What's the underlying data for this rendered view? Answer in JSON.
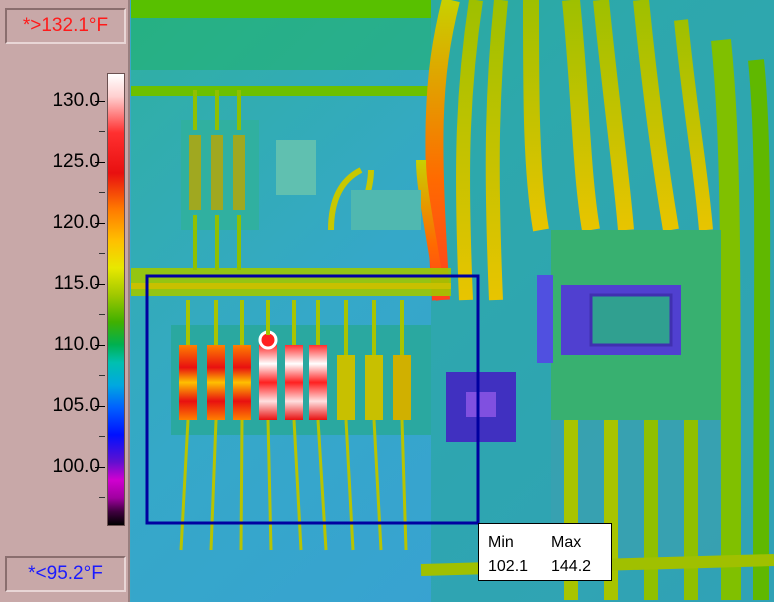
{
  "scale": {
    "max_readout": "*>132.1°F",
    "min_readout": "*<95.2°F",
    "ticks": [
      "130.0",
      "125.0",
      "120.0",
      "115.0",
      "110.0",
      "105.0",
      "100.0"
    ]
  },
  "stats": {
    "min_label": "Min",
    "max_label": "Max",
    "min_value": "102.1",
    "max_value": "144.2"
  },
  "colors": {
    "roi_outline": "#0000a0",
    "background_cool": "#3aa8c8",
    "hot": "#ff2020"
  }
}
